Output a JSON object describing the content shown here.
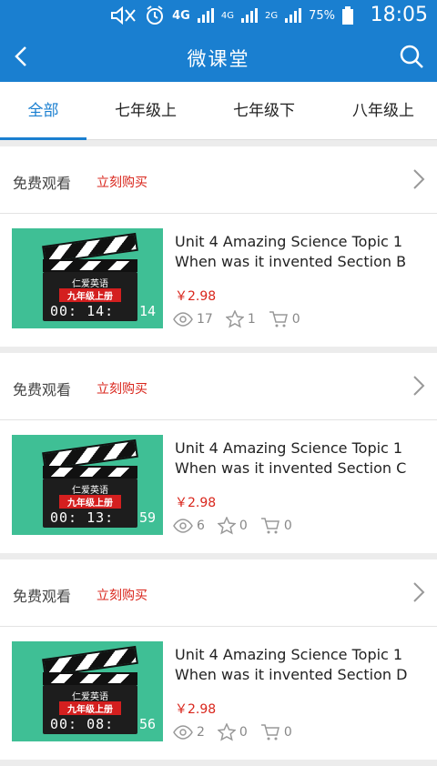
{
  "status_bar": {
    "battery_percent": "75%",
    "time": "18:05",
    "network_1": "4G",
    "network_2": "4G",
    "network_3": "2G",
    "icons": [
      "mute-icon",
      "alarm-icon",
      "signal-icon",
      "battery-icon"
    ]
  },
  "appbar": {
    "title": "微课堂",
    "back_icon": "chevron-left-icon",
    "search_icon": "search-icon"
  },
  "tabs": [
    {
      "label": "全部",
      "active": true
    },
    {
      "label": "七年级上",
      "active": false
    },
    {
      "label": "七年级下",
      "active": false
    },
    {
      "label": "八年级上",
      "active": false
    }
  ],
  "colors": {
    "accent": "#1a7fd0",
    "price": "#d9261c",
    "thumb_bg": "#3fbf95"
  },
  "courses": [
    {
      "free_label": "免费观看",
      "buy_label": "立刻购买",
      "thumb_line1": "仁爱英语",
      "thumb_line2": "九年级上册",
      "thumb_time": "00: 14:",
      "thumb_sec": "14",
      "title_line1": "Unit 4 Amazing Science Topic 1",
      "title_line2": "When was it invented Section B",
      "price": "￥2.98",
      "views": "17",
      "stars": "1",
      "cart": "0"
    },
    {
      "free_label": "免费观看",
      "buy_label": "立刻购买",
      "thumb_line1": "仁爱英语",
      "thumb_line2": "九年级上册",
      "thumb_time": "00: 13:",
      "thumb_sec": "59",
      "title_line1": "Unit 4 Amazing Science Topic 1",
      "title_line2": "When was it invented Section C",
      "price": "￥2.98",
      "views": "6",
      "stars": "0",
      "cart": "0"
    },
    {
      "free_label": "免费观看",
      "buy_label": "立刻购买",
      "thumb_line1": "仁爱英语",
      "thumb_line2": "九年级上册",
      "thumb_time": "00: 08:",
      "thumb_sec": "56",
      "title_line1": "Unit 4 Amazing Science Topic 1",
      "title_line2": "When was it invented Section D",
      "price": "￥2.98",
      "views": "2",
      "stars": "0",
      "cart": "0"
    }
  ]
}
